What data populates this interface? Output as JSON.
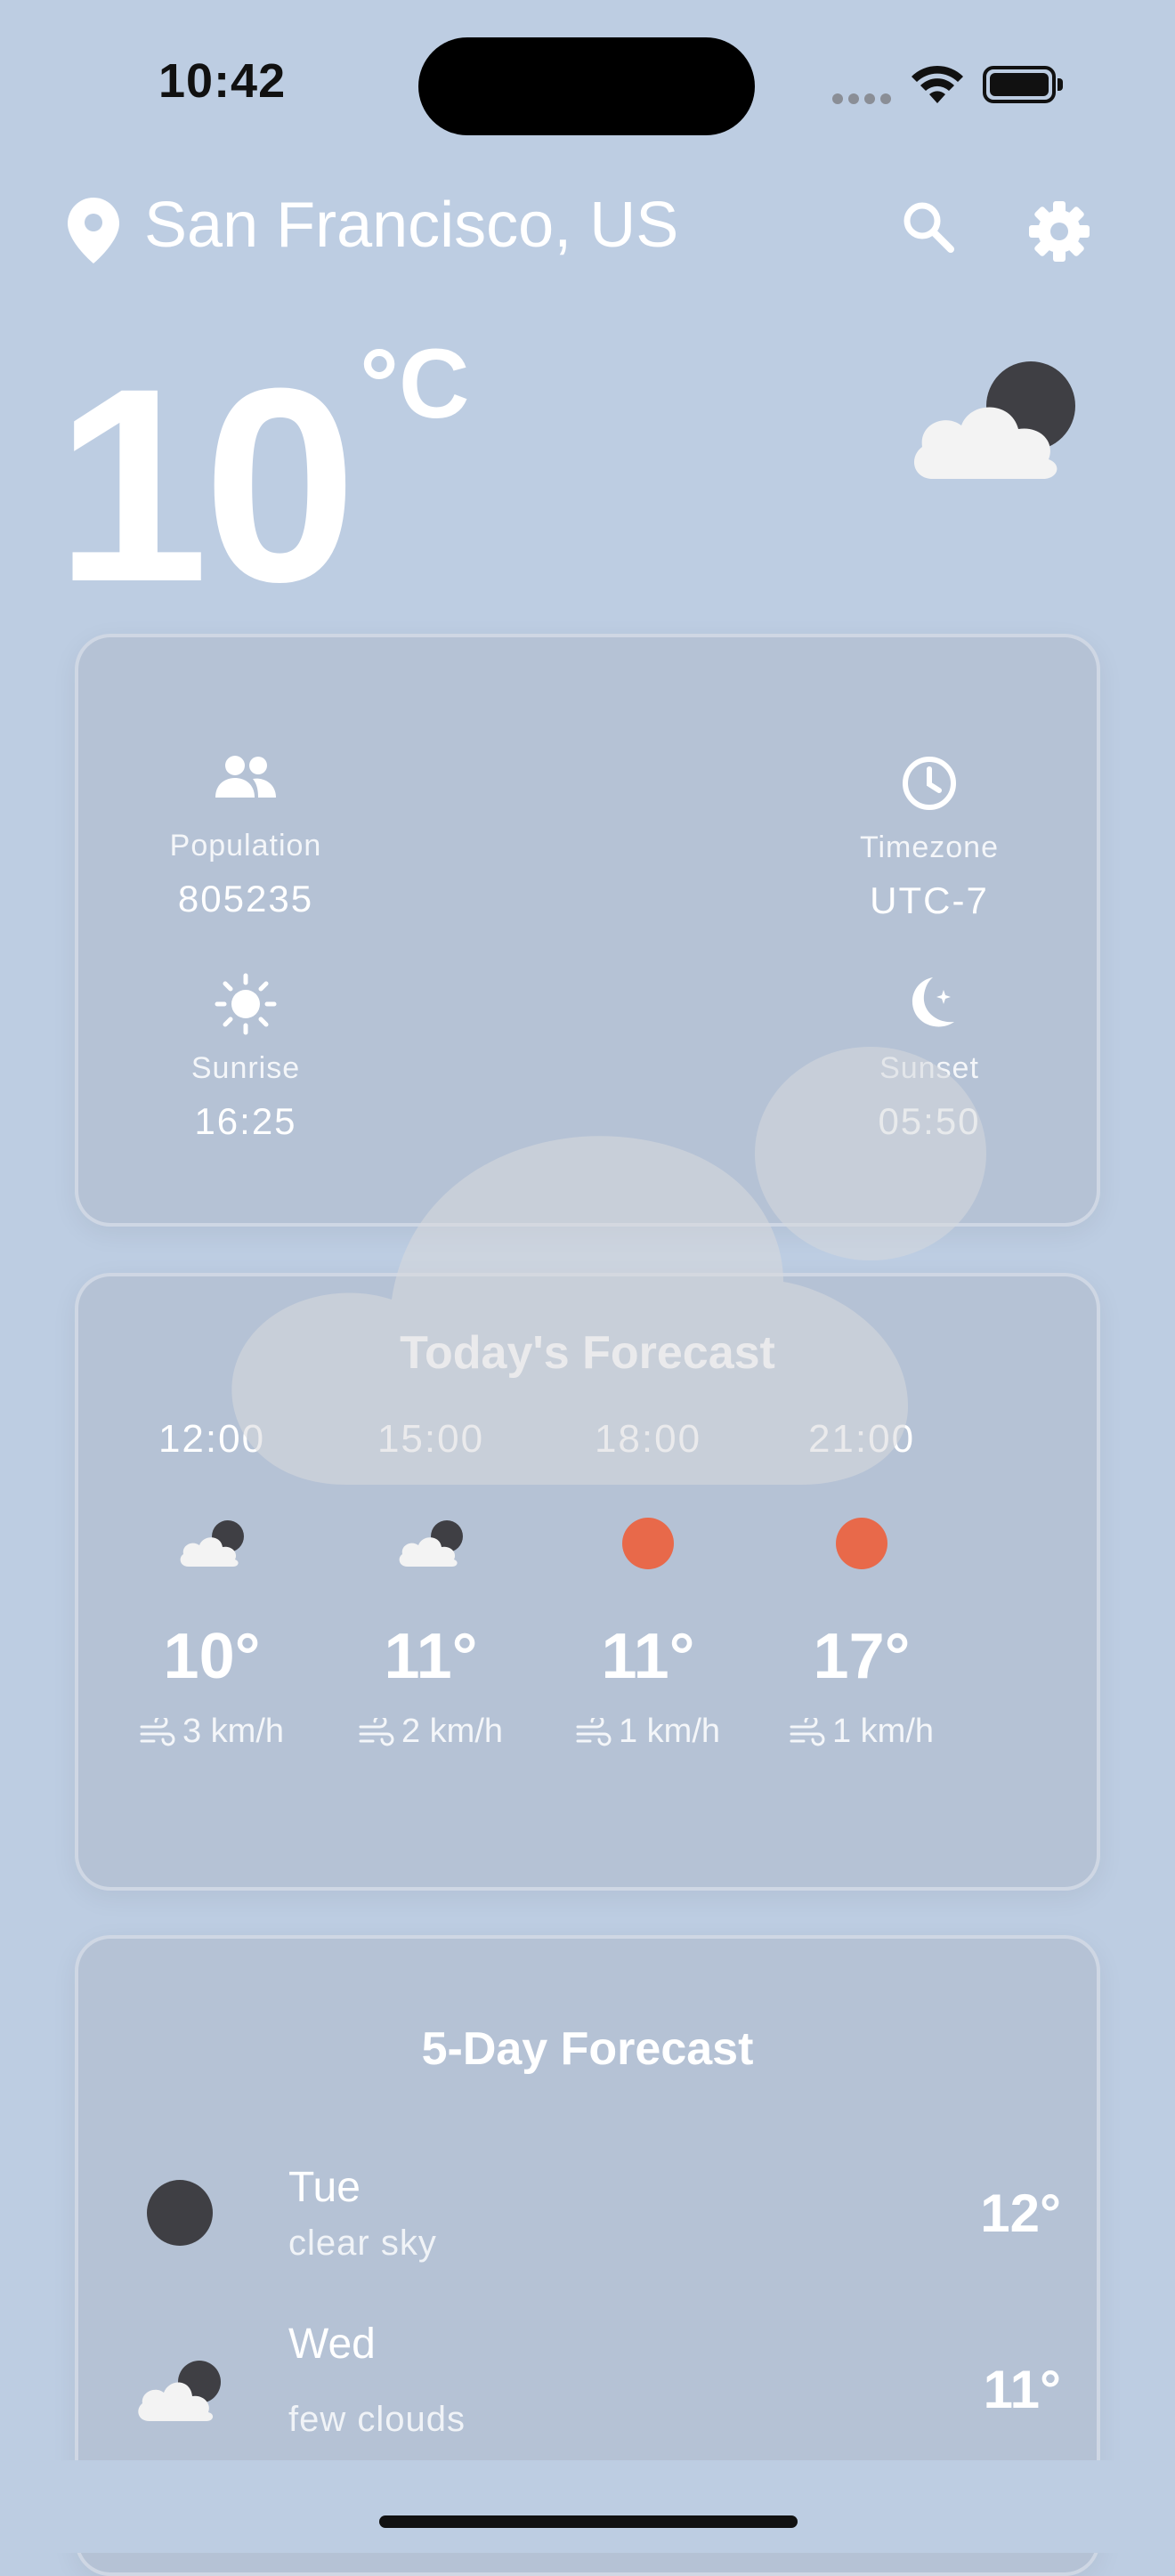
{
  "status_bar": {
    "time": "10:42"
  },
  "header": {
    "location": "San Francisco, US",
    "icons": {
      "location": "location-pin-icon",
      "search": "search-icon",
      "settings": "gear-icon"
    }
  },
  "current": {
    "temperature": "10",
    "unit": "°C",
    "condition_icon": "partly-cloudy-night-icon"
  },
  "city_info": {
    "population": {
      "label": "Population",
      "value": "805235",
      "icon": "people-icon"
    },
    "timezone": {
      "label": "Timezone",
      "value": "UTC-7",
      "icon": "clock-icon"
    },
    "sunrise": {
      "label": "Sunrise",
      "value": "16:25",
      "icon": "sun-icon"
    },
    "sunset": {
      "label": "Sunset",
      "value": "05:50",
      "icon": "moon-icon"
    }
  },
  "today": {
    "title": "Today's Forecast",
    "hours": [
      {
        "time": "12:00",
        "temp": "10°",
        "wind": "3 km/h",
        "icon": "partly-cloudy-night-icon"
      },
      {
        "time": "15:00",
        "temp": "11°",
        "wind": "2 km/h",
        "icon": "partly-cloudy-night-icon"
      },
      {
        "time": "18:00",
        "temp": "11°",
        "wind": "1 km/h",
        "icon": "sun-icon"
      },
      {
        "time": "21:00",
        "temp": "17°",
        "wind": "1 km/h",
        "icon": "sun-icon"
      }
    ]
  },
  "five_day": {
    "title": "5-Day Forecast",
    "days": [
      {
        "day": "Tue",
        "desc": "clear sky",
        "temp": "12°",
        "icon": "clear-night-icon"
      },
      {
        "day": "Wed",
        "desc": "few clouds",
        "temp": "11°",
        "icon": "partly-cloudy-night-icon"
      }
    ]
  },
  "colors": {
    "background": "#bdcde2",
    "sun": "#e8694a",
    "moon": "#3f3f44",
    "cloud": "#f3f3f3"
  }
}
